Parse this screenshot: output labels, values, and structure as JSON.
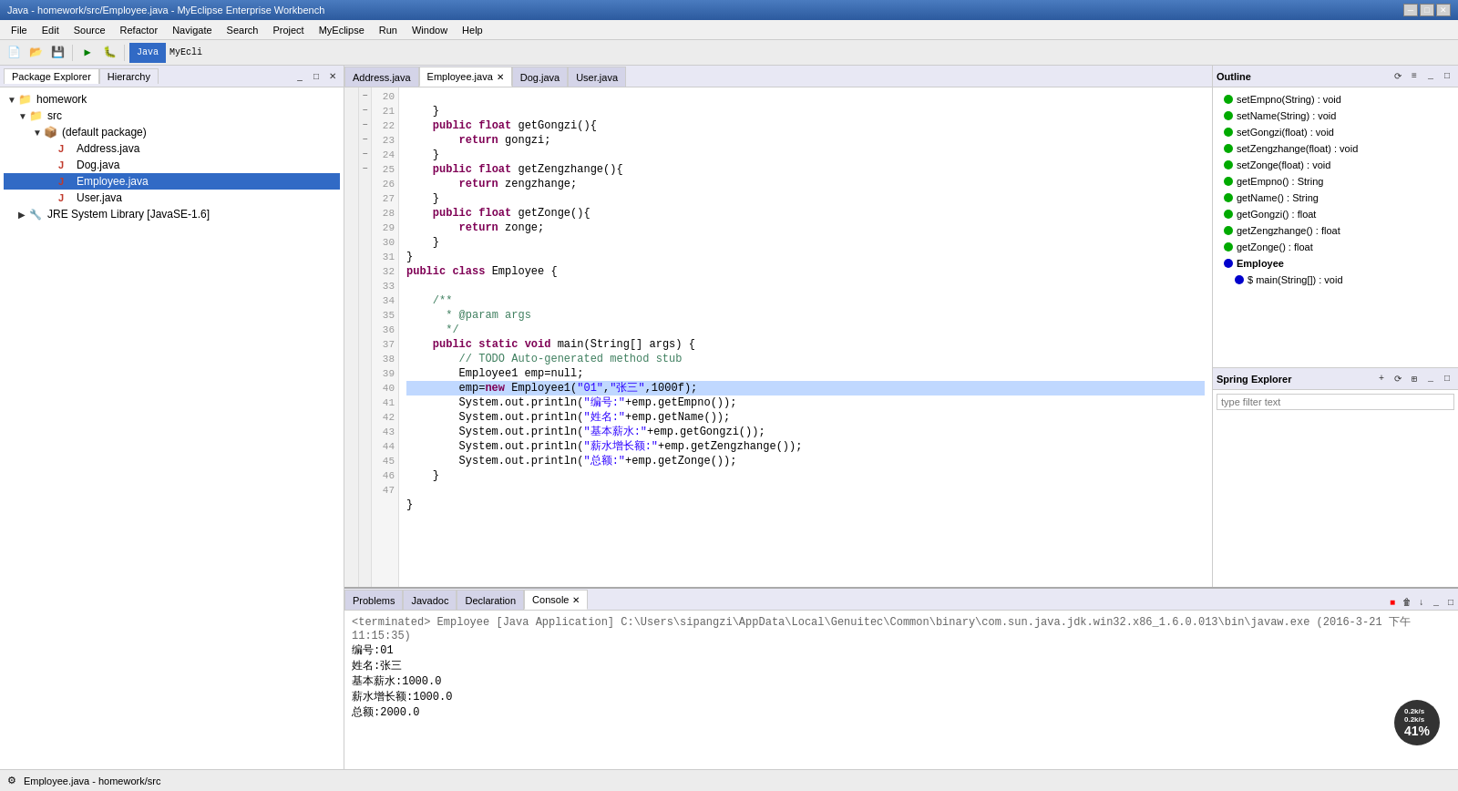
{
  "titleBar": {
    "text": "Java - homework/src/Employee.java - MyEclipse Enterprise Workbench"
  },
  "menuBar": {
    "items": [
      "File",
      "Edit",
      "Source",
      "Refactor",
      "Navigate",
      "Search",
      "Project",
      "MyEclipse",
      "Run",
      "Window",
      "Help"
    ]
  },
  "leftPanel": {
    "tabs": [
      "Package Explorer",
      "Hierarchy"
    ],
    "activeTab": "Package Explorer",
    "tree": {
      "root": "homework",
      "items": [
        {
          "label": "homework",
          "indent": 0,
          "type": "folder",
          "expanded": true
        },
        {
          "label": "src",
          "indent": 1,
          "type": "folder",
          "expanded": true
        },
        {
          "label": "(default package)",
          "indent": 2,
          "type": "package",
          "expanded": true
        },
        {
          "label": "Address.java",
          "indent": 3,
          "type": "java"
        },
        {
          "label": "Dog.java",
          "indent": 3,
          "type": "java"
        },
        {
          "label": "Employee.java",
          "indent": 3,
          "type": "java",
          "selected": true
        },
        {
          "label": "User.java",
          "indent": 3,
          "type": "java"
        },
        {
          "label": "JRE System Library [JavaSE-1.6]",
          "indent": 1,
          "type": "library"
        }
      ]
    }
  },
  "editorTabs": [
    {
      "label": "Address.java",
      "active": false,
      "modified": false
    },
    {
      "label": "Employee.java",
      "active": true,
      "modified": false
    },
    {
      "label": "Dog.java",
      "active": false,
      "modified": false
    },
    {
      "label": "User.java",
      "active": false,
      "modified": false
    }
  ],
  "codeLines": [
    "    }",
    "    public float getGongzi(){",
    "        return gongzi;",
    "    }",
    "    public float getZengzhange(){",
    "        return zengzhange;",
    "    }",
    "    public float getZonge(){",
    "        return zonge;",
    "    }",
    "}",
    "public class Employee {",
    "    ",
    "    /**",
    "     * @param args",
    "     */",
    "    public static void main(String[] args) {",
    "        // TODO Auto-generated method stub",
    "        Employee1 emp=null;",
    "        emp=new Employee1(\"01\",\"张三\",1000f);",
    "        System.out.println(\"编号:\"+emp.getEmpno());",
    "        System.out.println(\"姓名:\"+emp.getName());",
    "        System.out.println(\"基本薪水:\"+emp.getGongzi());",
    "        System.out.println(\"薪水增长额:\"+emp.getZengzhange());",
    "        System.out.println(\"总额:\"+emp.getZonge());",
    "    }",
    "    ",
    "}"
  ],
  "lineNumberStart": 20,
  "outlinePanel": {
    "title": "Outline",
    "methods": [
      {
        "label": "setEmpno(String) : void",
        "type": "method"
      },
      {
        "label": "setName(String) : void",
        "type": "method"
      },
      {
        "label": "setGongzi(float) : void",
        "type": "method"
      },
      {
        "label": "setZengzhange(float) : void",
        "type": "method"
      },
      {
        "label": "setZonge(float) : void",
        "type": "method"
      },
      {
        "label": "getEmpno() : String",
        "type": "method"
      },
      {
        "label": "getName() : String",
        "type": "method"
      },
      {
        "label": "getGongzi() : float",
        "type": "method"
      },
      {
        "label": "getZengzhange() : float",
        "type": "method"
      },
      {
        "label": "getZonge() : float",
        "type": "method"
      },
      {
        "label": "Employee",
        "type": "class"
      },
      {
        "label": "$ main(String[]) : void",
        "type": "main"
      }
    ]
  },
  "springExplorer": {
    "title": "Spring Explorer",
    "filterPlaceholder": "type filter text"
  },
  "bottomPanel": {
    "tabs": [
      "Problems",
      "Javadoc",
      "Declaration",
      "Console"
    ],
    "activeTab": "Console",
    "console": {
      "terminated": "<terminated> Employee [Java Application] C:\\Users\\sipangzi\\AppData\\Local\\Genuitec\\Common\\binary\\com.sun.java.jdk.win32.x86_1.6.0.013\\bin\\javaw.exe (2016-3-21 下午11:15:35)",
      "output": [
        "编号:01",
        "姓名:张三",
        "基本薪水:1000.0",
        "薪水增长额:1000.0",
        "总额:2000.0"
      ]
    }
  },
  "statusBar": {
    "text": "Employee.java - homework/src",
    "networkSpeed": "0.2k/s",
    "cpuPercent": "41%"
  }
}
